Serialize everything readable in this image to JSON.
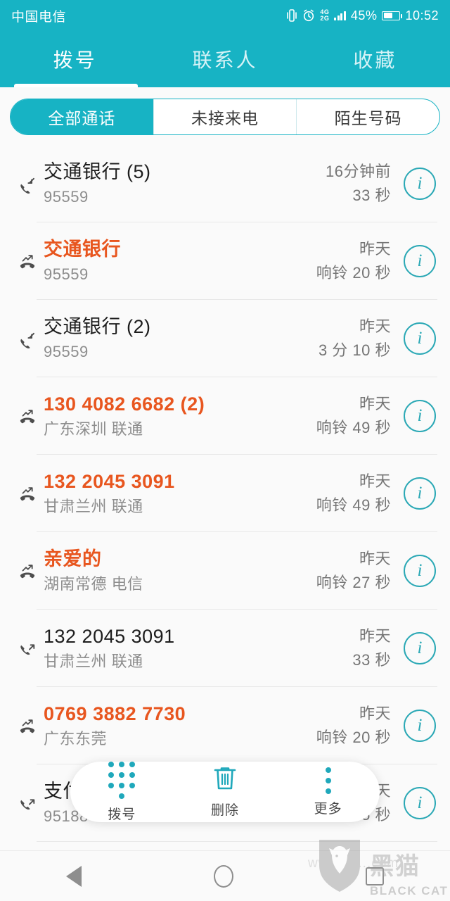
{
  "status_bar": {
    "carrier": "中国电信",
    "network_4g": "4G",
    "network_2g": "2G",
    "battery_percent": "45%",
    "time": "10:52",
    "icons": [
      "vibrate-icon",
      "alarm-icon",
      "signal-bars-icon",
      "battery-icon"
    ]
  },
  "tabs": [
    {
      "label": "拨号",
      "name": "tab-dialer",
      "active": true
    },
    {
      "label": "联系人",
      "name": "tab-contacts",
      "active": false
    },
    {
      "label": "收藏",
      "name": "tab-favorites",
      "active": false
    }
  ],
  "filters": [
    {
      "label": "全部通话",
      "name": "filter-all-calls",
      "active": true
    },
    {
      "label": "未接来电",
      "name": "filter-missed-calls",
      "active": false
    },
    {
      "label": "陌生号码",
      "name": "filter-unknown-numbers",
      "active": false
    }
  ],
  "calls": [
    {
      "title": "交通银行 (5)",
      "sub": "95559",
      "time": "16分钟前",
      "duration": "33 秒",
      "type": "incoming",
      "missed": false
    },
    {
      "title": "交通银行",
      "sub": "95559",
      "time": "昨天",
      "duration": "响铃 20 秒",
      "type": "missed",
      "missed": true
    },
    {
      "title": "交通银行 (2)",
      "sub": "95559",
      "time": "昨天",
      "duration": "3 分 10 秒",
      "type": "incoming",
      "missed": false
    },
    {
      "title": "130 4082 6682 (2)",
      "sub": "广东深圳 联通",
      "time": "昨天",
      "duration": "响铃 49 秒",
      "type": "missed",
      "missed": true
    },
    {
      "title": "132 2045 3091",
      "sub": "甘肃兰州 联通",
      "time": "昨天",
      "duration": "响铃 49 秒",
      "type": "missed",
      "missed": true
    },
    {
      "title": "亲爱的",
      "sub": "湖南常德 电信",
      "time": "昨天",
      "duration": "响铃 27 秒",
      "type": "missed",
      "missed": true
    },
    {
      "title": "132 2045 3091",
      "sub": "甘肃兰州 联通",
      "time": "昨天",
      "duration": "33 秒",
      "type": "outgoing",
      "missed": false
    },
    {
      "title": "0769 3882 7730",
      "sub": "广东东莞",
      "time": "昨天",
      "duration": "响铃 20 秒",
      "type": "missed",
      "missed": true
    },
    {
      "title": "支付宝",
      "sub": "95188",
      "time": "昨天",
      "duration": "1 分 15 秒",
      "type": "outgoing",
      "missed": false
    }
  ],
  "bottom_bar": [
    {
      "label": "拨号",
      "name": "bottombar-dial",
      "icon": "dialpad-icon"
    },
    {
      "label": "删除",
      "name": "bottombar-delete",
      "icon": "trash-icon"
    },
    {
      "label": "更多",
      "name": "bottombar-more",
      "icon": "more-vertical-icon"
    }
  ],
  "navbar": [
    {
      "name": "nav-back-button",
      "icon": "triangle-back-icon"
    },
    {
      "name": "nav-home-button",
      "icon": "circle-home-icon"
    },
    {
      "name": "nav-recents-button",
      "icon": "square-recents-icon"
    }
  ],
  "watermark": {
    "url": "www.vi....com",
    "han": "黑猫",
    "en": "BLACK CAT"
  },
  "colors": {
    "accent": "#17b3c4",
    "missed": "#e8561f",
    "info": "#2aa8b5",
    "background": "#fafafa"
  }
}
